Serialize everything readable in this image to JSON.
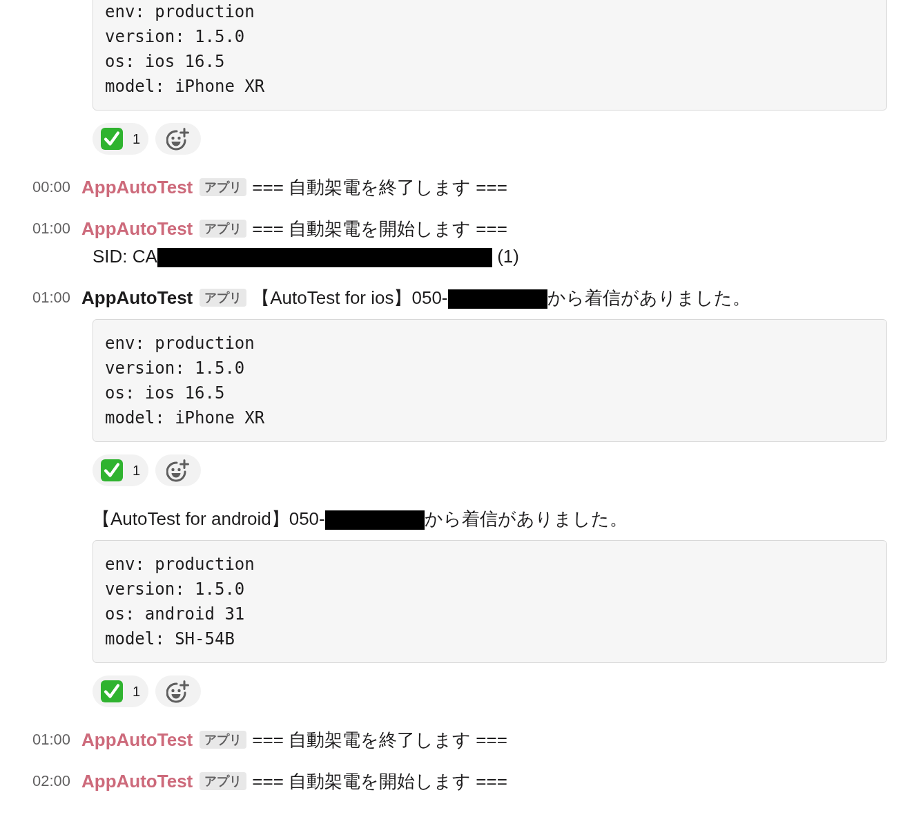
{
  "messages": [
    {
      "body": [
        {
          "kind": "code",
          "lines": [
            "env: production",
            "version: 1.5.0",
            "os: ios 16.5",
            "model: iPhone XR"
          ]
        },
        {
          "kind": "reactions",
          "items": [
            {
              "count": "1"
            }
          ]
        }
      ]
    },
    {
      "time": "00:00",
      "sender": "AppAutoTest",
      "color": "#cd6a7b",
      "badge": "アプリ",
      "text": [
        {
          "kind": "plain",
          "text": "=== 自動架電を終了します ==="
        }
      ]
    },
    {
      "time": "01:00",
      "sender": "AppAutoTest",
      "color": "#cd6a7b",
      "badge": "アプリ",
      "text": [
        {
          "kind": "plain",
          "text": "=== 自動架電を開始します ==="
        }
      ],
      "body": [
        {
          "kind": "line",
          "parts": [
            {
              "kind": "plain",
              "text": "SID: CA"
            },
            {
              "kind": "longmask"
            },
            {
              "kind": "plain",
              "text": " (1)"
            }
          ]
        }
      ]
    },
    {
      "time": "01:00",
      "sender": "AppAutoTest",
      "color": "#1d1c1d",
      "badge": "アプリ",
      "text": [
        {
          "kind": "plain",
          "text": "【AutoTest for ios】050-"
        },
        {
          "kind": "mask"
        },
        {
          "kind": "plain",
          "text": "から着信がありました。"
        }
      ],
      "body": [
        {
          "kind": "code",
          "lines": [
            "env: production",
            "version: 1.5.0",
            "os: ios 16.5",
            "model: iPhone XR"
          ]
        },
        {
          "kind": "reactions",
          "items": [
            {
              "count": "1"
            }
          ]
        }
      ]
    },
    {
      "body": [
        {
          "kind": "line",
          "parts": [
            {
              "kind": "plain",
              "text": "【AutoTest for android】050-"
            },
            {
              "kind": "mask"
            },
            {
              "kind": "plain",
              "text": "から着信がありました。"
            }
          ]
        },
        {
          "kind": "code",
          "lines": [
            "env: production",
            "version: 1.5.0",
            "os: android 31",
            "model: SH-54B"
          ]
        },
        {
          "kind": "reactions",
          "items": [
            {
              "count": "1"
            }
          ]
        }
      ]
    },
    {
      "time": "01:00",
      "sender": "AppAutoTest",
      "color": "#cd6a7b",
      "badge": "アプリ",
      "text": [
        {
          "kind": "plain",
          "text": "=== 自動架電を終了します ==="
        }
      ]
    },
    {
      "time": "02:00",
      "sender": "AppAutoTest",
      "color": "#cd6a7b",
      "badge": "アプリ",
      "text": [
        {
          "kind": "plain",
          "text": "=== 自動架電を開始します ==="
        }
      ]
    }
  ]
}
